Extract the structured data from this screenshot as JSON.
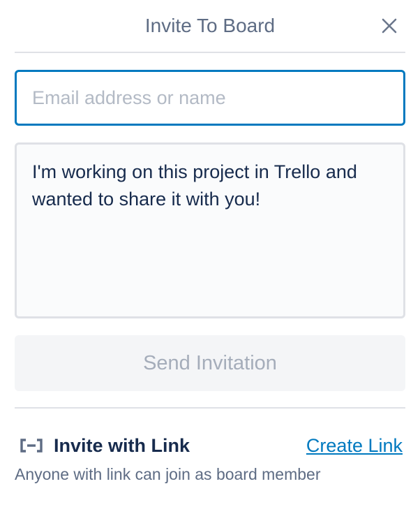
{
  "header": {
    "title": "Invite To Board",
    "close_icon": "close-icon"
  },
  "form": {
    "email_placeholder": "Email address or name",
    "email_value": "",
    "message_text": "I'm working on this project in Trello and wanted to share it with you!",
    "send_label": "Send Invitation",
    "send_enabled": false
  },
  "invite_link": {
    "icon": "link-icon",
    "title": "Invite with Link",
    "action_label": "Create Link",
    "description": "Anyone with link can join as board member"
  },
  "colors": {
    "accent": "#0079bf",
    "text_primary": "#172b4d",
    "text_secondary": "#5e6c84",
    "border": "#dfe1e6",
    "disabled_text": "#a5adba"
  }
}
